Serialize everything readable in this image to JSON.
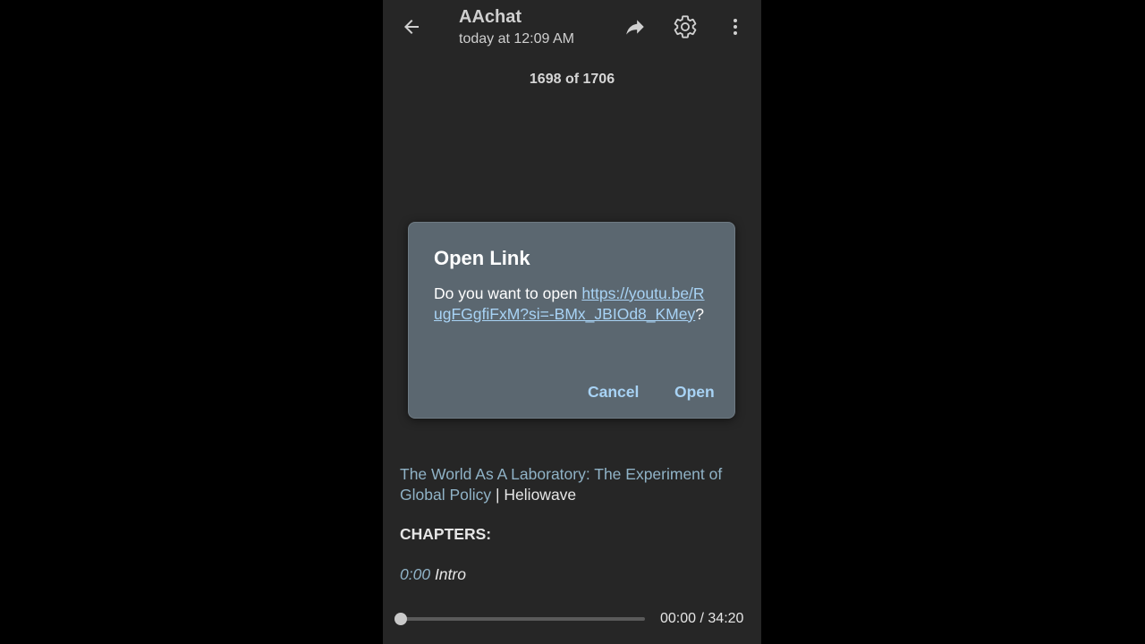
{
  "header": {
    "title": "AAchat",
    "subtitle": "today at 12:09 AM",
    "icons": [
      "back-arrow-icon",
      "share-icon",
      "gear-icon",
      "more-vert-icon"
    ]
  },
  "counter": "1698 of 1706",
  "dialog": {
    "title": "Open Link",
    "message_prefix": "Do you want to open ",
    "url": "https://youtu.be/RugFGgfiFxM?si=-BMx_JBIOd8_KMey",
    "message_suffix": "?",
    "cancel_label": "Cancel",
    "open_label": "Open"
  },
  "message": {
    "link_text": "The World As A Laboratory: The Experiment of Global Policy",
    "separator": " | ",
    "author": "Heliowave",
    "chapters_heading": "CHAPTERS:",
    "chapters": [
      {
        "time": "0:00",
        "name": "Intro"
      }
    ]
  },
  "player": {
    "current": "00:00",
    "separator": " / ",
    "duration": "34:20",
    "progress": 0
  },
  "colors": {
    "background": "#262626",
    "dialog_bg": "#5b6770",
    "link": "#a8d3f5",
    "message_link": "#90b3c7"
  }
}
